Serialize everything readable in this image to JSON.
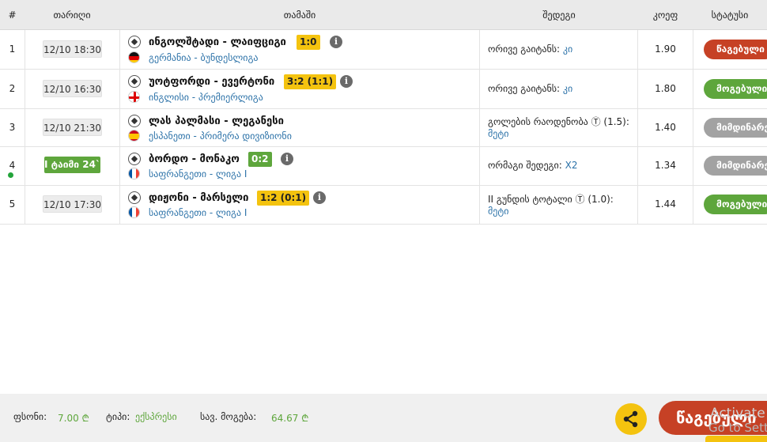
{
  "header": {
    "col_num": "#",
    "col_date": "თარიღი",
    "col_match": "თამაში",
    "col_bet": "შედეგი",
    "col_odd": "კოეფ",
    "col_status": "სტატუსი"
  },
  "rows": [
    {
      "num": "1",
      "date": "12/10 18:30",
      "live": false,
      "match": "ინგოლშტადი - ლაიფციგი",
      "score": "1:0",
      "country": "გერმანია",
      "sep": " - ",
      "league": "ბუნდესლიგა",
      "bet_text": "ორივე გაიტანს:",
      "bet_pick": "კი",
      "odd": "1.90",
      "status": "წაგებული",
      "status_type": "lost"
    },
    {
      "num": "2",
      "date": "12/10 16:30",
      "live": false,
      "match": "უოტფორდი - ევერტონი",
      "score": "3:2 (1:1)",
      "country": "ინგლისი",
      "sep": " - ",
      "league": "პრემიერლიგა",
      "bet_text": "ორივე გაიტანს:",
      "bet_pick": "კი",
      "odd": "1.80",
      "status": "მოგებული",
      "status_type": "won"
    },
    {
      "num": "3",
      "date": "12/10 21:30",
      "live": false,
      "match": "ლას პალმასი - ლეგანესი",
      "score": "",
      "country": "ესპანეთი",
      "sep": " - ",
      "league": "პრიმერა დივიზიონი",
      "bet_text": "გოლების რაოდენობა Ⓣ (1.5):",
      "bet_pick": "მეტი",
      "odd": "1.40",
      "status": "მიმდინარე",
      "status_type": "pending"
    },
    {
      "num": "4",
      "date": "I ტაიმი 24`",
      "live": true,
      "match": "ბორდო - მონაკო",
      "score": "0:2",
      "country": "საფრანგეთი",
      "sep": " - ",
      "league": "ლიგა I",
      "bet_text": "ორმაგი შედეგი:",
      "bet_pick": "X2",
      "odd": "1.34",
      "status": "მიმდინარე",
      "status_type": "pending"
    },
    {
      "num": "5",
      "date": "12/10 17:30",
      "live": false,
      "match": "დიჟონი - მარსელი",
      "score": "1:2 (0:1)",
      "country": "საფრანგეთი",
      "sep": " - ",
      "league": "ლიგა I",
      "bet_text": "II გუნდის ტოტალი Ⓣ (1.0):",
      "bet_pick": "მეტი",
      "odd": "1.44",
      "status": "მოგებული",
      "status_type": "won"
    }
  ],
  "footer": {
    "stake_label": "ფსონი:",
    "stake_value": "7.00 ₾",
    "type_label": "ტიპი:",
    "type_value": "ექსპრესი",
    "win_label": "სავ. მოგება:",
    "win_value": "64.67 ₾",
    "submit_label": "წაგებული"
  },
  "overlay": {
    "line1": "Activate",
    "line2": "Go to Setti"
  },
  "colors": {
    "won": "#5ea63c",
    "lost": "#c64125",
    "pending": "#a2a2a2",
    "score": "#f4c30f",
    "link": "#2c72a8"
  },
  "icons": {
    "sport": "soccer-ball-icon",
    "info": "info-icon",
    "share": "share-icon"
  }
}
